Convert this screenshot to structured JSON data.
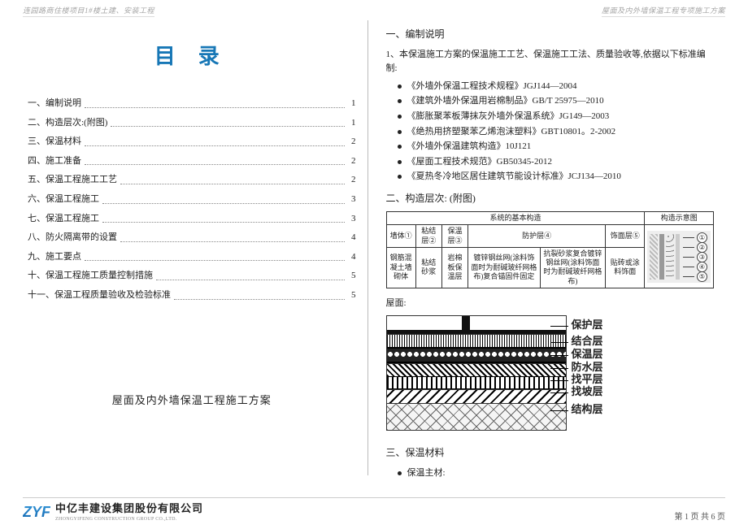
{
  "header": {
    "left": "连园路商住楼项目1#楼土建、安装工程",
    "right": "屋面及内外墙保温工程专项施工方案"
  },
  "toc": {
    "title": "目录",
    "items": [
      {
        "label": "一、编制说明",
        "page": "1"
      },
      {
        "label": "二、构造层次:(附图)",
        "page": "1"
      },
      {
        "label": "三、保温材料",
        "page": "2"
      },
      {
        "label": "四、施工准备",
        "page": "2"
      },
      {
        "label": "五、保温工程施工工艺",
        "page": "2"
      },
      {
        "label": "六、保温工程施工",
        "page": "3"
      },
      {
        "label": "七、保温工程施工",
        "page": "3"
      },
      {
        "label": "八、防火隔离带的设置",
        "page": "4"
      },
      {
        "label": "九、施工要点",
        "page": "4"
      },
      {
        "label": "十、保温工程施工质量控制措施",
        "page": "5"
      },
      {
        "label": "十一、保温工程质量验收及检验标准",
        "page": "5"
      }
    ],
    "subtitle": "屋面及内外墙保温工程施工方案"
  },
  "right": {
    "s1_title": "一、编制说明",
    "s1_intro": "1、本保温施工方案的保温施工工艺、保温施工工法、质量验收等,依据以下标准编制:",
    "standards": [
      "《外墙外保温工程技术规程》JGJ144—2004",
      "《建筑外墙外保温用岩棉制品》GB/T 25975—2010",
      "《膨胀聚苯板薄抹灰外墙外保温系统》JG149—2003",
      "《绝热用挤塑聚苯乙烯泡沫塑料》GBT10801。2-2002",
      "《外墙外保温建筑构造》10J121",
      "《屋面工程技术规范》GB50345-2012",
      "《夏热冬冷地区居住建筑节能设计标准》JCJ134—2010"
    ],
    "s2_title": "二、构造层次: (附图)",
    "table": {
      "head_main": "系统的基本构造",
      "head_diag": "构造示意图",
      "row1": [
        "墙体①",
        "粘结层②",
        "保温层③",
        "防护层④",
        "饰面层⑤"
      ],
      "row2": [
        "钢筋混凝土墙砌体",
        "粘结砂浆",
        "岩棉板保温层",
        "镀锌钢丝网(涂料饰面时为耐碱玻纤网格布)复合锚固件固定",
        "抗裂砂浆复合镀锌钢丝网(涂料饰面时为耐碱玻纤网格布)",
        "贴砖或涂料饰面"
      ],
      "tags": [
        "①",
        "②",
        "③",
        "④",
        "⑤"
      ]
    },
    "roof_label": "屋面:",
    "layers": [
      "保护层",
      "结合层",
      "保温层",
      "防水层",
      "找平层",
      "找坡层",
      "结构层"
    ],
    "s3_title": "三、保温材料",
    "s3_item": "保温主材:"
  },
  "footer": {
    "logo_mark": "ZYF",
    "logo_zh": "中亿丰建设集团股份有限公司",
    "logo_en": "ZHONGYIFENG CONSTRUCTION GROUP CO.,LTD.",
    "page": "第 1 页 共 6 页"
  }
}
